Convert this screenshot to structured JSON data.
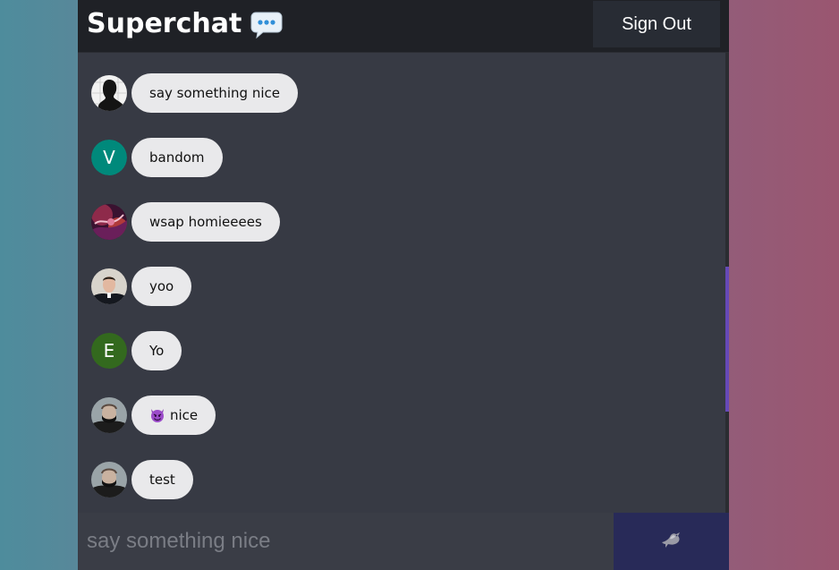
{
  "header": {
    "title": "Superchat",
    "title_icon": "speech-balloon-icon",
    "sign_out_label": "Sign Out"
  },
  "messages": [
    {
      "avatar": "silhouette-photo",
      "text": "say something nice"
    },
    {
      "avatar": "letter",
      "avatar_letter": "V",
      "avatar_color": "#00897b",
      "text": "bandom"
    },
    {
      "avatar": "abstract-art-photo",
      "text": "wsap homieeees"
    },
    {
      "avatar": "portrait-photo",
      "text": "yoo"
    },
    {
      "avatar": "letter",
      "avatar_letter": "E",
      "avatar_color": "#33691e",
      "text": "Yo"
    },
    {
      "avatar": "masked-person-photo",
      "emoji": "smiling-devil-icon",
      "text": "nice"
    },
    {
      "avatar": "masked-person-photo",
      "text": "test"
    }
  ],
  "composer": {
    "placeholder": "say something nice",
    "value": "",
    "send_icon": "dove-icon"
  },
  "colors": {
    "app_background": "#373a44",
    "header_background": "#1f2126",
    "bubble_background": "#e9e9eb",
    "send_button": "#282a58",
    "scroll_thumb": "#6649b8"
  }
}
